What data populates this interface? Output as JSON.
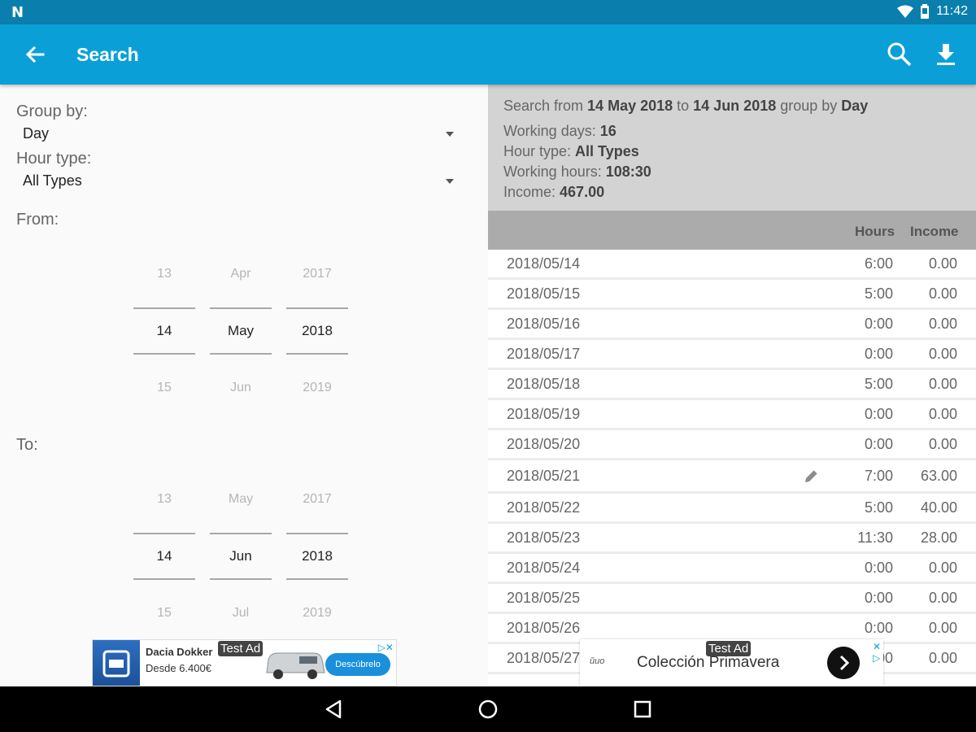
{
  "status_bar": {
    "time": "11:42"
  },
  "app_bar": {
    "title": "Search"
  },
  "form": {
    "group_by_label": "Group by:",
    "group_by_value": "Day",
    "hour_type_label": "Hour type:",
    "hour_type_value": "All Types",
    "from_label": "From:",
    "to_label": "To:",
    "from_picker": {
      "day": {
        "prev": "13",
        "selected": "14",
        "next": "15"
      },
      "month": {
        "prev": "Apr",
        "selected": "May",
        "next": "Jun"
      },
      "year": {
        "prev": "2017",
        "selected": "2018",
        "next": "2019"
      }
    },
    "to_picker": {
      "day": {
        "prev": "13",
        "selected": "14",
        "next": "15"
      },
      "month": {
        "prev": "May",
        "selected": "Jun",
        "next": "Jul"
      },
      "year": {
        "prev": "2017",
        "selected": "2018",
        "next": "2019"
      }
    }
  },
  "summary": {
    "search_prefix": "Search from ",
    "from": "14 May 2018",
    "to_word": " to ",
    "to": "14 Jun 2018",
    "group_word": " group by ",
    "group": "Day",
    "working_days_label": "Working days: ",
    "working_days": "16",
    "hour_type_label": "Hour type: ",
    "hour_type": "All Types",
    "working_hours_label": "Working hours: ",
    "working_hours": "108:30",
    "income_label": "Income: ",
    "income": "467.00"
  },
  "table": {
    "headers": {
      "hours": "Hours",
      "income": "Income"
    },
    "rows": [
      {
        "date": "2018/05/14",
        "hours": "6:00",
        "income": "0.00"
      },
      {
        "date": "2018/05/15",
        "hours": "5:00",
        "income": "0.00"
      },
      {
        "date": "2018/05/16",
        "hours": "0:00",
        "income": "0.00"
      },
      {
        "date": "2018/05/17",
        "hours": "0:00",
        "income": "0.00"
      },
      {
        "date": "2018/05/18",
        "hours": "5:00",
        "income": "0.00"
      },
      {
        "date": "2018/05/19",
        "hours": "0:00",
        "income": "0.00"
      },
      {
        "date": "2018/05/20",
        "hours": "0:00",
        "income": "0.00"
      },
      {
        "date": "2018/05/21",
        "hours": "7:00",
        "income": "63.00",
        "has_note": true
      },
      {
        "date": "2018/05/22",
        "hours": "5:00",
        "income": "40.00"
      },
      {
        "date": "2018/05/23",
        "hours": "11:30",
        "income": "28.00"
      },
      {
        "date": "2018/05/24",
        "hours": "0:00",
        "income": "0.00"
      },
      {
        "date": "2018/05/25",
        "hours": "0:00",
        "income": "0.00"
      },
      {
        "date": "2018/05/26",
        "hours": "0:00",
        "income": "0.00"
      },
      {
        "date": "2018/05/27",
        "hours": "0:00",
        "income": "0.00"
      }
    ]
  },
  "ads": {
    "ad1": {
      "badge": "Test Ad",
      "title": "Dacia Dokker",
      "subtitle": "Desde 6.400€",
      "cta": "Descúbrelo"
    },
    "ad2": {
      "badge": "Test Ad",
      "text": "Colección Primavera"
    }
  },
  "colors": {
    "status_bar": "#0a7fad",
    "app_bar": "#0aa0d7",
    "summary_bg": "#d3d3d3",
    "header_bg": "#ababab"
  }
}
